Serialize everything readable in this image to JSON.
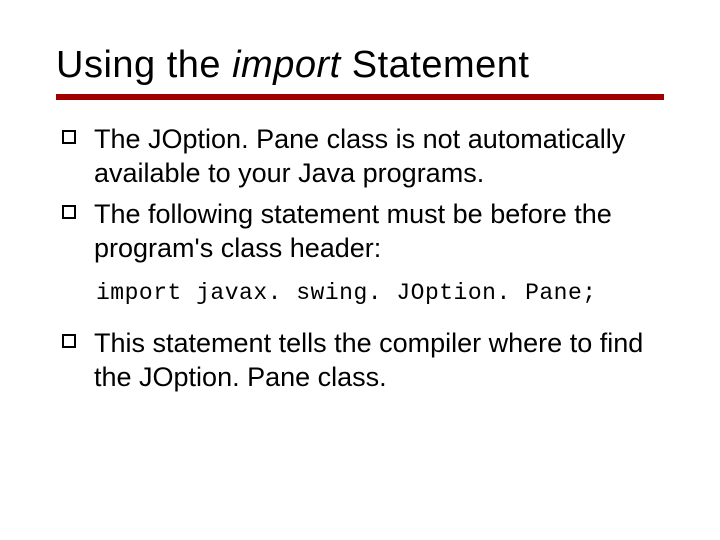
{
  "title": {
    "prefix": "Using the ",
    "italic": "import",
    "suffix": " Statement"
  },
  "bullets": [
    "The JOption. Pane class is not automatically available to your Java programs.",
    "The following statement must be before the program's class header:"
  ],
  "code": "import javax. swing. JOption. Pane;",
  "bullets2": [
    "This statement tells the compiler where to find the JOption. Pane class."
  ]
}
